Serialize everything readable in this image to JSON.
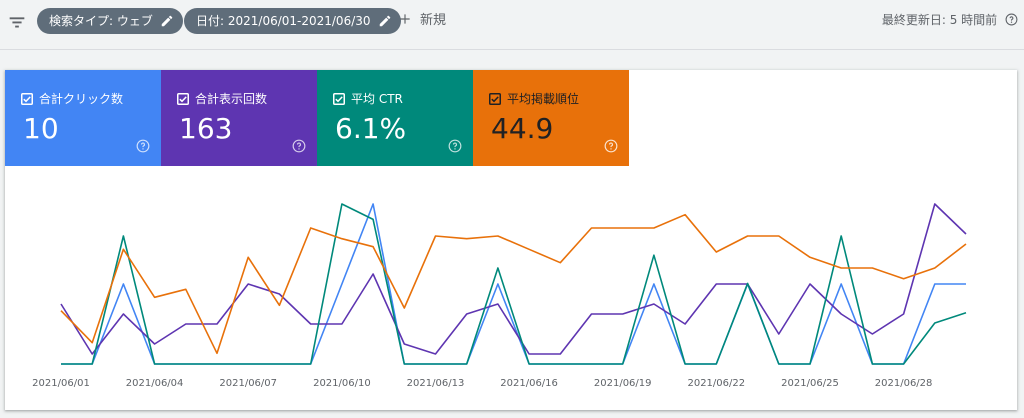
{
  "toolbar": {
    "filter_icon": "filter-list-icon",
    "chip_search_type": "検索タイプ: ウェブ",
    "chip_date": "日付: 2021/06/01-2021/06/30",
    "new_label": "新規",
    "last_updated": "最終更新日: 5 時間前"
  },
  "metrics": [
    {
      "label": "合計クリック数",
      "value": "10",
      "color": "#4285f4",
      "checked": true
    },
    {
      "label": "合計表示回数",
      "value": "163",
      "color": "#5e35b1",
      "checked": true
    },
    {
      "label": "平均 CTR",
      "value": "6.1%",
      "color": "#00897b",
      "checked": true
    },
    {
      "label": "平均掲載順位",
      "value": "44.9",
      "color": "#e8710a",
      "checked": true
    }
  ],
  "chart_data": {
    "type": "line",
    "title": "",
    "x": [
      "2021/06/01",
      "2021/06/02",
      "2021/06/03",
      "2021/06/04",
      "2021/06/05",
      "2021/06/06",
      "2021/06/07",
      "2021/06/08",
      "2021/06/09",
      "2021/06/10",
      "2021/06/11",
      "2021/06/12",
      "2021/06/13",
      "2021/06/14",
      "2021/06/15",
      "2021/06/16",
      "2021/06/17",
      "2021/06/18",
      "2021/06/19",
      "2021/06/20",
      "2021/06/21",
      "2021/06/22",
      "2021/06/23",
      "2021/06/24",
      "2021/06/25",
      "2021/06/26",
      "2021/06/27",
      "2021/06/28",
      "2021/06/29",
      "2021/06/30"
    ],
    "tick_labels": [
      "2021/06/01",
      "2021/06/04",
      "2021/06/07",
      "2021/06/10",
      "2021/06/13",
      "2021/06/16",
      "2021/06/19",
      "2021/06/22",
      "2021/06/25",
      "2021/06/28"
    ],
    "grid": false,
    "legend": "none",
    "series": [
      {
        "name": "合計クリック数",
        "color": "#4285f4",
        "values": [
          0,
          0,
          1,
          0,
          0,
          0,
          0,
          0,
          0,
          1,
          2,
          0,
          0,
          0,
          1,
          0,
          0,
          0,
          0,
          1,
          0,
          0,
          1,
          0,
          0,
          1,
          0,
          0,
          1,
          1
        ]
      },
      {
        "name": "合計表示回数",
        "color": "#5e35b1",
        "values": [
          6,
          1,
          5,
          2,
          4,
          4,
          8,
          7,
          4,
          4,
          9,
          2,
          1,
          5,
          6,
          1,
          1,
          5,
          5,
          6,
          4,
          8,
          8,
          3,
          8,
          5,
          3,
          5,
          16,
          13
        ]
      },
      {
        "name": "平均 CTR",
        "color": "#00897b",
        "values": [
          0,
          0,
          100,
          0,
          0,
          0,
          0,
          0,
          0,
          125,
          113,
          0,
          0,
          0,
          75,
          0,
          0,
          0,
          0,
          85,
          0,
          0,
          63,
          0,
          0,
          100,
          0,
          0,
          32,
          40
        ]
      },
      {
        "name": "平均掲載順位",
        "color": "#e8710a",
        "values": [
          80,
          92,
          57,
          75,
          72,
          96,
          60,
          78,
          49,
          53,
          56,
          79,
          52,
          53,
          52,
          57,
          62,
          49,
          49,
          49,
          44,
          58,
          52,
          52,
          60,
          64,
          64,
          68,
          64,
          55
        ]
      }
    ]
  }
}
